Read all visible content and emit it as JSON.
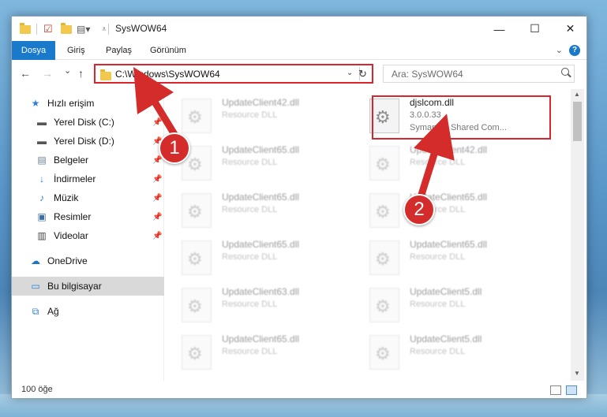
{
  "window": {
    "title": "SysWOW64",
    "min_glyph": "—",
    "max_glyph": "☐",
    "close_glyph": "✕"
  },
  "ribbon": {
    "tabs": [
      {
        "label": "Dosya"
      },
      {
        "label": "Giriş"
      },
      {
        "label": "Paylaş"
      },
      {
        "label": "Görünüm"
      }
    ],
    "help_glyph": "?"
  },
  "nav": {
    "back_glyph": "←",
    "forward_glyph": "→",
    "recent_glyph": "⌄",
    "up_glyph": "↑",
    "address": "C:\\Windows\\SysWOW64",
    "dropdown_glyph": "⌄",
    "refresh_glyph": "↻",
    "search_placeholder": "Ara: SysWOW64"
  },
  "sidebar": {
    "items": [
      {
        "label": "Hızlı erişim",
        "icon": "star-icon"
      },
      {
        "label": "Yerel Disk (C:)",
        "icon": "drive-icon"
      },
      {
        "label": "Yerel Disk (D:)",
        "icon": "drive-icon"
      },
      {
        "label": "Belgeler",
        "icon": "documents-icon"
      },
      {
        "label": "İndirmeler",
        "icon": "download-icon"
      },
      {
        "label": "Müzik",
        "icon": "music-icon"
      },
      {
        "label": "Resimler",
        "icon": "pictures-icon"
      },
      {
        "label": "Videolar",
        "icon": "videos-icon"
      },
      {
        "label": "OneDrive",
        "icon": "cloud-icon"
      },
      {
        "label": "Bu bilgisayar",
        "icon": "computer-icon"
      },
      {
        "label": "Ağ",
        "icon": "network-icon"
      }
    ]
  },
  "files": {
    "highlighted": {
      "name": "djslcom.dll",
      "version": "3.0.0.33",
      "description": "Symantec Shared Com..."
    },
    "left_column": [
      {
        "name": "UpdateClient42.dll",
        "type": "Resource DLL"
      },
      {
        "name": "UpdateClient65.dll",
        "type": "Resource DLL"
      },
      {
        "name": "UpdateClient65.dll",
        "type": "Resource DLL"
      },
      {
        "name": "UpdateClient65.dll",
        "type": "Resource DLL"
      },
      {
        "name": "UpdateClient63.dll",
        "type": "Resource DLL"
      },
      {
        "name": "UpdateClient65.dll",
        "type": "Resource DLL"
      }
    ],
    "right_column": [
      {
        "name": "UpdateClient42.dll",
        "type": "Resource DLL"
      },
      {
        "name": "UpdateClient65.dll",
        "type": "Resource DLL"
      },
      {
        "name": "UpdateClient65.dll",
        "type": "Resource DLL"
      },
      {
        "name": "UpdateClient5.dll",
        "type": "Resource DLL"
      },
      {
        "name": "UpdateClient5.dll",
        "type": "Resource DLL"
      }
    ]
  },
  "status": {
    "item_count": "100 öğe"
  },
  "annotations": {
    "badge_1": "1",
    "badge_2": "2",
    "color": "#d9262e"
  }
}
